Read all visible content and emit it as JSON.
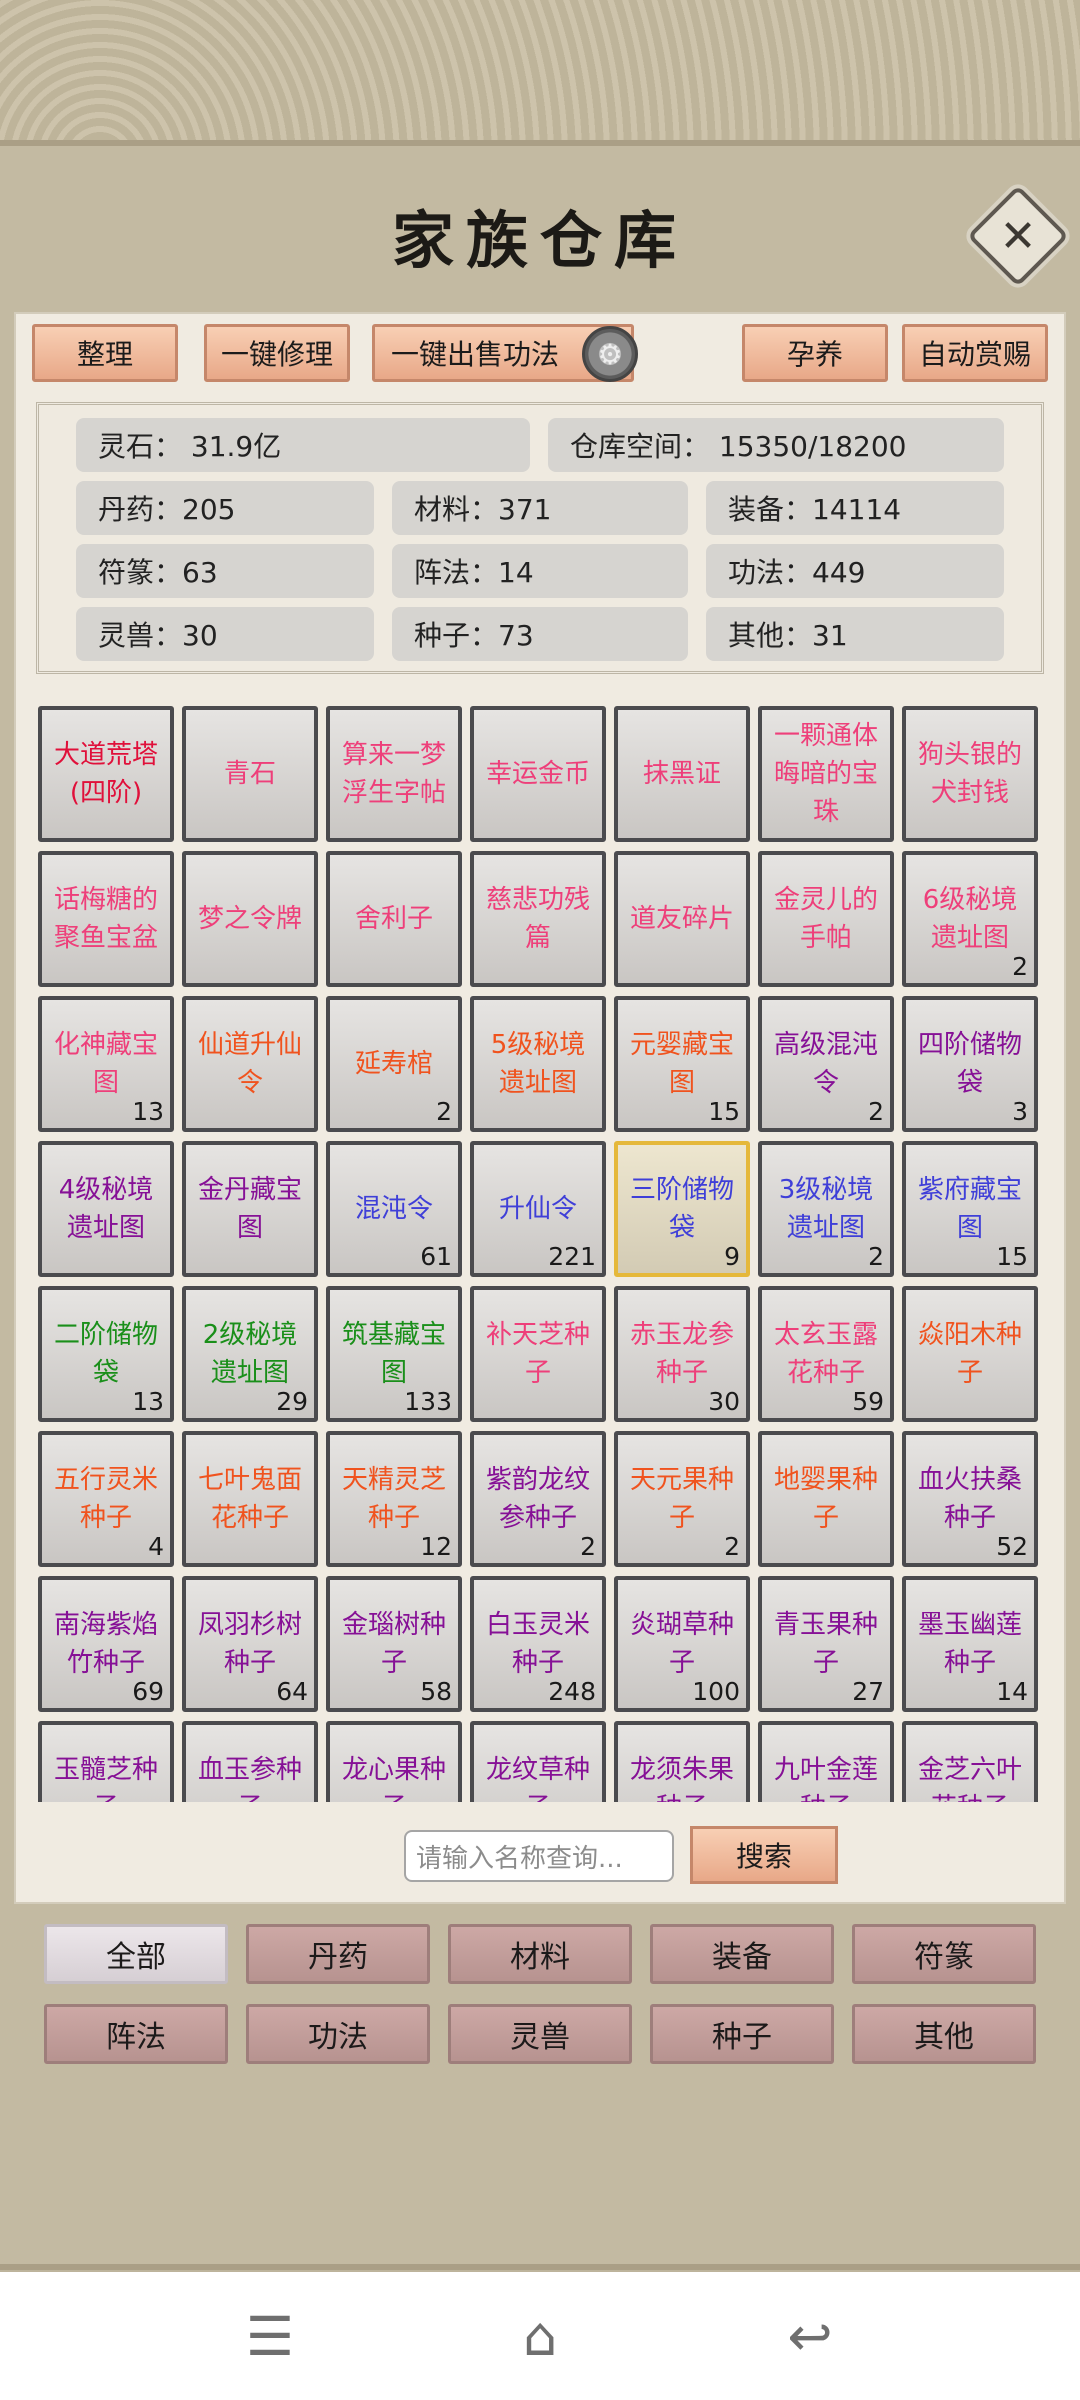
{
  "title": "家族仓库",
  "toolbar": {
    "sort": "整理",
    "repair": "一键修理",
    "sell": "一键出售功法",
    "nurture": "孕养",
    "reward": "自动赏赐"
  },
  "stats": {
    "lingshi": "灵石： 31.9亿",
    "space": "仓库空间：   15350/18200",
    "danyao": "丹药：205",
    "cailiao": "材料：371",
    "zhuangbei": "装备：14114",
    "fulu": "符篆：63",
    "zhenfa": "阵法：14",
    "gongfa": "功法：449",
    "lingshou": "灵兽：30",
    "zhongzi": "种子：73",
    "qita": "其他：31"
  },
  "items": [
    {
      "name": "大道荒塔(四阶)",
      "count": "",
      "color": "#e0103a"
    },
    {
      "name": "青石",
      "count": "",
      "color": "#ee3f7a"
    },
    {
      "name": "算来一梦浮生字帖",
      "count": "",
      "color": "#ee3f7a"
    },
    {
      "name": "幸运金币",
      "count": "",
      "color": "#ee3f7a"
    },
    {
      "name": "抹黑证",
      "count": "",
      "color": "#ee3f7a"
    },
    {
      "name": "一颗通体晦暗的宝珠",
      "count": "",
      "color": "#ee3f7a"
    },
    {
      "name": "狗头银的犬封钱",
      "count": "",
      "color": "#ee3f7a"
    },
    {
      "name": "话梅糖的聚鱼宝盆",
      "count": "",
      "color": "#ee3f7a"
    },
    {
      "name": "梦之令牌",
      "count": "",
      "color": "#ee3f7a"
    },
    {
      "name": "舍利子",
      "count": "",
      "color": "#ee3f7a"
    },
    {
      "name": "慈悲功残篇",
      "count": "",
      "color": "#ee3f7a"
    },
    {
      "name": "道友碎片",
      "count": "",
      "color": "#ee3f7a"
    },
    {
      "name": "金灵儿的手帕",
      "count": "",
      "color": "#ee3f7a"
    },
    {
      "name": "6级秘境遗址图",
      "count": "2",
      "color": "#ee3f7a"
    },
    {
      "name": "化神藏宝图",
      "count": "13",
      "color": "#ee3f7a"
    },
    {
      "name": "仙道升仙令",
      "count": "",
      "color": "#f0531e"
    },
    {
      "name": "延寿棺",
      "count": "2",
      "color": "#f0531e"
    },
    {
      "name": "5级秘境遗址图",
      "count": "",
      "color": "#f0531e"
    },
    {
      "name": "元婴藏宝图",
      "count": "15",
      "color": "#f0531e"
    },
    {
      "name": "高级混沌令",
      "count": "2",
      "color": "#861096"
    },
    {
      "name": "四阶储物袋",
      "count": "3",
      "color": "#861096"
    },
    {
      "name": "4级秘境遗址图",
      "count": "",
      "color": "#861096"
    },
    {
      "name": "金丹藏宝图",
      "count": "",
      "color": "#861096"
    },
    {
      "name": "混沌令",
      "count": "61",
      "color": "#3f3fd8"
    },
    {
      "name": "升仙令",
      "count": "221",
      "color": "#3f3fd8"
    },
    {
      "name": "三阶储物袋",
      "count": "9",
      "color": "#3f3fd8"
    },
    {
      "name": "3级秘境遗址图",
      "count": "2",
      "color": "#3f3fd8"
    },
    {
      "name": "紫府藏宝图",
      "count": "15",
      "color": "#3f3fd8"
    },
    {
      "name": "二阶储物袋",
      "count": "13",
      "color": "#1a8f1a"
    },
    {
      "name": "2级秘境遗址图",
      "count": "29",
      "color": "#1a8f1a"
    },
    {
      "name": "筑基藏宝图",
      "count": "133",
      "color": "#1a8f1a"
    },
    {
      "name": "补天芝种子",
      "count": "",
      "color": "#ee3f7a"
    },
    {
      "name": "赤玉龙参种子",
      "count": "30",
      "color": "#ee3f7a"
    },
    {
      "name": "太玄玉露花种子",
      "count": "59",
      "color": "#ee3f7a"
    },
    {
      "name": "焱阳木种子",
      "count": "",
      "color": "#f0531e"
    },
    {
      "name": "五行灵米种子",
      "count": "4",
      "color": "#f0531e"
    },
    {
      "name": "七叶鬼面花种子",
      "count": "",
      "color": "#f0531e"
    },
    {
      "name": "天精灵芝种子",
      "count": "12",
      "color": "#f0531e"
    },
    {
      "name": "紫韵龙纹参种子",
      "count": "2",
      "color": "#861096"
    },
    {
      "name": "天元果种子",
      "count": "2",
      "color": "#f0531e"
    },
    {
      "name": "地婴果种子",
      "count": "",
      "color": "#f0531e"
    },
    {
      "name": "血火扶桑种子",
      "count": "52",
      "color": "#861096"
    },
    {
      "name": "南海紫焰竹种子",
      "count": "69",
      "color": "#861096"
    },
    {
      "name": "凤羽杉树种子",
      "count": "64",
      "color": "#861096"
    },
    {
      "name": "金瑙树种子",
      "count": "58",
      "color": "#861096"
    },
    {
      "name": "白玉灵米种子",
      "count": "248",
      "color": "#861096"
    },
    {
      "name": "炎瑚草种子",
      "count": "100",
      "color": "#861096"
    },
    {
      "name": "青玉果种子",
      "count": "27",
      "color": "#861096"
    },
    {
      "name": "墨玉幽莲种子",
      "count": "14",
      "color": "#861096"
    },
    {
      "name": "玉髓芝种子",
      "count": "",
      "color": "#861096"
    },
    {
      "name": "血玉参种子",
      "count": "",
      "color": "#861096"
    },
    {
      "name": "龙心果种子",
      "count": "",
      "color": "#861096"
    },
    {
      "name": "龙纹草种子",
      "count": "",
      "color": "#861096"
    },
    {
      "name": "龙须朱果种子",
      "count": "",
      "color": "#861096"
    },
    {
      "name": "九叶金莲种子",
      "count": "",
      "color": "#861096"
    },
    {
      "name": "金芝六叶花种子",
      "count": "",
      "color": "#861096"
    }
  ],
  "search": {
    "placeholder": "请输入名称查询...",
    "button": "搜索"
  },
  "categories": [
    "全部",
    "丹药",
    "材料",
    "装备",
    "符篆",
    "阵法",
    "功法",
    "灵兽",
    "种子",
    "其他"
  ],
  "navbar": {
    "menu_icon": "menu-icon",
    "home_icon": "home-icon",
    "back_icon": "back-icon"
  }
}
